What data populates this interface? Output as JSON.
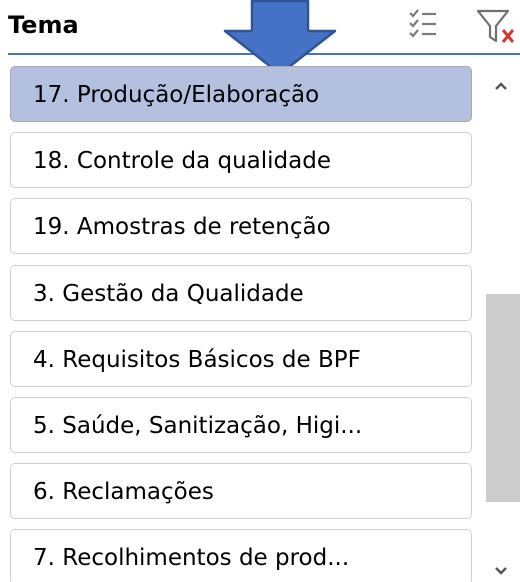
{
  "slicer": {
    "title": "Tema",
    "accent_color": "#4472c4",
    "selected_color": "#b4c0e0",
    "multiselect_button": {
      "icon": "multi-select-icon"
    },
    "clear_filter_button": {
      "icon": "clear-filter-icon"
    },
    "annotation_arrow": {
      "icon": "down-arrow-icon",
      "color": "#4472c4"
    },
    "items": [
      {
        "label": "17. Produção/Elaboração",
        "selected": true
      },
      {
        "label": "18. Controle da qualidade",
        "selected": false
      },
      {
        "label": "19. Amostras de retenção",
        "selected": false
      },
      {
        "label": "3. Gestão da Qualidade",
        "selected": false
      },
      {
        "label": "4. Requisitos Básicos de BPF",
        "selected": false
      },
      {
        "label": "5. Saúde, Sanitização, Higi...",
        "selected": false
      },
      {
        "label": "6. Reclamações",
        "selected": false
      },
      {
        "label": "7. Recolhimentos de prod...",
        "selected": false
      }
    ],
    "scrollbar": {
      "up_icon": "chevron-up-icon",
      "down_icon": "chevron-down-icon"
    }
  }
}
